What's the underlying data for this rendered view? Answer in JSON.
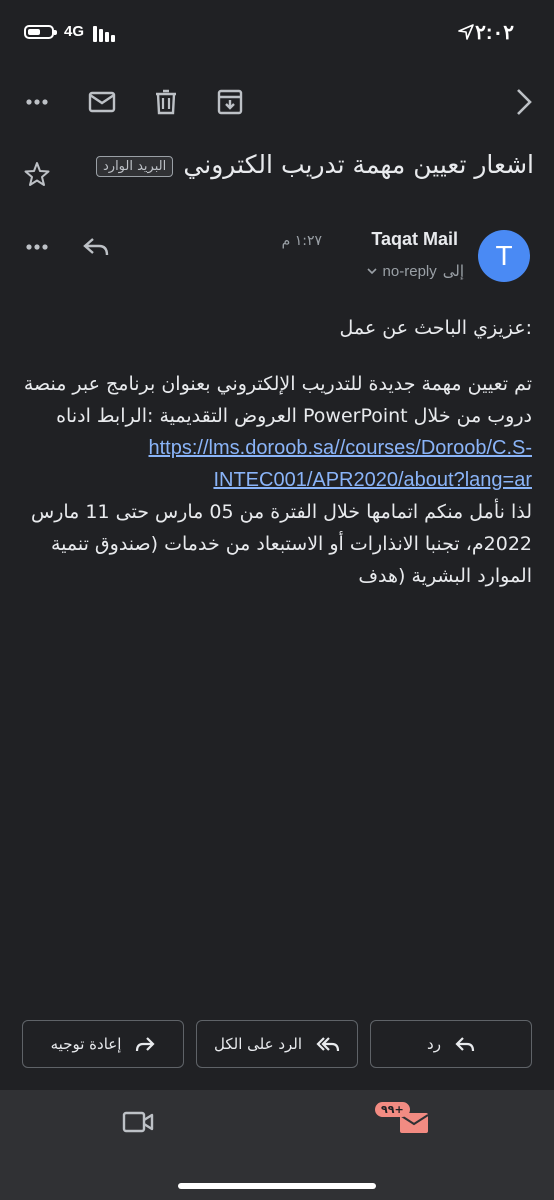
{
  "status_bar": {
    "time": "٢:٠٢",
    "network": "4G"
  },
  "email": {
    "subject": "اشعار تعيين مهمة تدريب الكتروني",
    "label": "البريد الوارد",
    "sender_initial": "T",
    "sender_name": "Taqat Mail",
    "time": "١:٢٧ م",
    "to_prefix": "إلى",
    "to": "no-reply",
    "body_greeting": ":عزيزي الباحث عن عمل",
    "body_line1": "تم تعيين مهمة جديدة للتدريب الإلكتروني بعنوان برنامج عبر منصة دروب من خلال PowerPoint العروض التقديمية :الرابط ادناه",
    "link": "https://lms.doroob.sa//courses/Doroob/C.S-INTEC001/APR2020/about?lang=ar",
    "body_line2": "لذا نأمل منكم اتمامها خلال الفترة من 05 مارس حتى 11 مارس 2022م، تجنبا الانذارات أو الاستبعاد من خدمات (صندوق تنمية الموارد البشرية (هدف"
  },
  "actions": {
    "reply": "رد",
    "reply_all": "الرد على الكل",
    "forward": "إعادة توجيه"
  },
  "bottom_nav": {
    "mail_badge": "+٩٩"
  },
  "colors": {
    "background": "#202124",
    "accent_link": "#8ab4f8",
    "avatar": "#4a8af4",
    "badge": "#f28b82"
  }
}
